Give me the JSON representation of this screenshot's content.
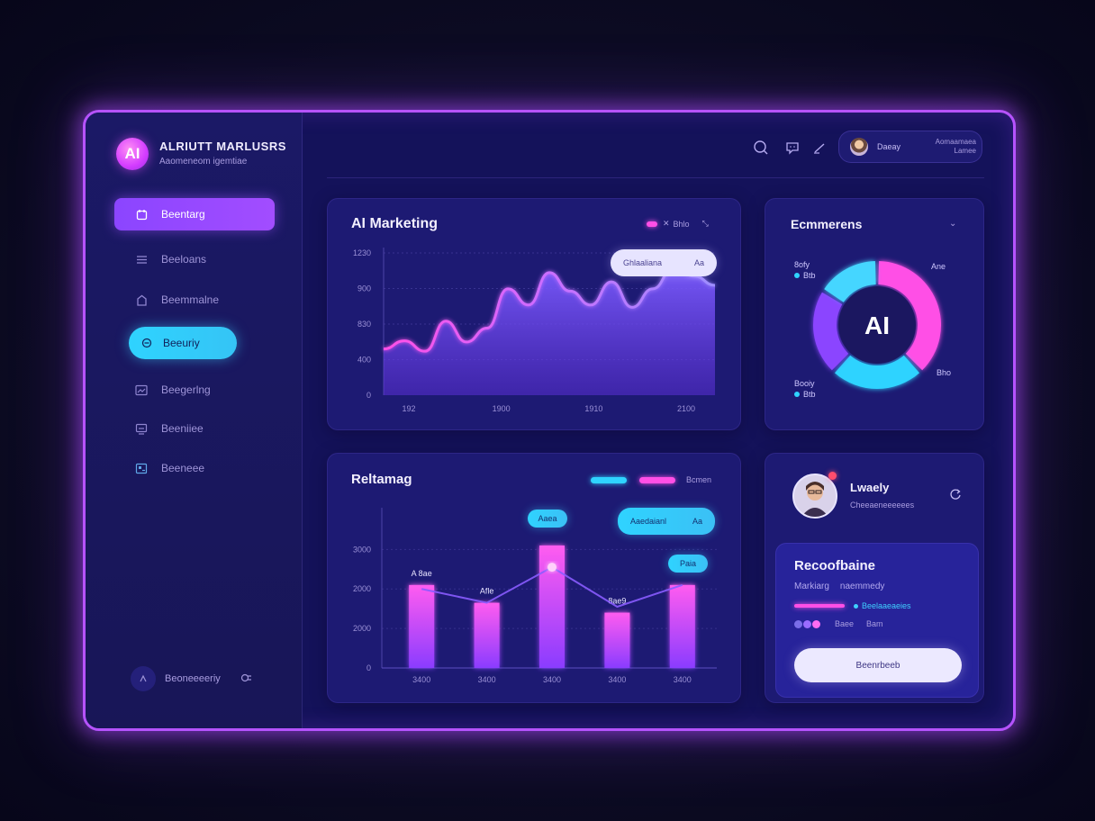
{
  "brand": {
    "logo": "AI",
    "title": "ALRIUTT MARLUSRS",
    "subtitle": "Aaomeneom igemtiae"
  },
  "sidebar": {
    "items": [
      {
        "label": "Beentarg",
        "icon": "calendar-icon"
      },
      {
        "label": "Beeloans",
        "icon": "list-icon"
      },
      {
        "label": "Beemmalne",
        "icon": "home-icon"
      },
      {
        "label": "Beeuriy",
        "icon": "shield-icon"
      },
      {
        "label": "Beegerlng",
        "icon": "image-icon"
      },
      {
        "label": "Beeniiee",
        "icon": "monitor-icon"
      },
      {
        "label": "Beeneee",
        "icon": "grid-icon"
      }
    ],
    "settings_label": "Beoneeeeriy"
  },
  "topbar": {
    "icons": [
      "search-icon",
      "chat-icon",
      "edit-icon"
    ],
    "profile_name": "Daeay",
    "profile_right_top": "Aomaamaea",
    "profile_right_bottom": "Lamee"
  },
  "marketing_card": {
    "title": "AI Marketing",
    "legend_text": "Bhlo",
    "tooltip": "Ghlaaliana",
    "tooltip_suffix": "Aa"
  },
  "ecommerce_card": {
    "title": "Ecmmerens",
    "center_label": "AI",
    "label_tl": "8ofy",
    "label_tl_sub": "Btb",
    "label_tr": "Ane",
    "label_bl": "Booiy",
    "label_bl_sub": "Btb",
    "label_br": "Bho"
  },
  "bar_card": {
    "title": "Reltamag",
    "legend_text": "Bcmen",
    "tooltip_top": "Aaea",
    "tooltip_right": "Aaedaianl",
    "tooltip_right_suffix": "Aa",
    "tooltip_rightmost": "Paia",
    "bar_labels": [
      "A 8ae",
      "Afle",
      "",
      "8ae9",
      ""
    ]
  },
  "profile_card": {
    "name": "Lwaely",
    "subtitle": "Cheeaeneeeeees",
    "rec_title": "Recoofbaine",
    "rec_sub_left": "Markiarg",
    "rec_sub_right": "naemmedy",
    "rec_line_label": "Beelaaeaeies",
    "rec_dots_label": "Baee",
    "rec_dots_right": "Bam",
    "button": "Beenrbeeb"
  },
  "colors": {
    "accent_purple": "#a24dff",
    "accent_cyan": "#2fd3ff",
    "accent_pink": "#ff4fe6",
    "frame": "#b653ff"
  },
  "chart_data": [
    {
      "type": "area",
      "title": "AI Marketing",
      "x_ticks": [
        "192",
        "1900",
        "1910",
        "2100"
      ],
      "y_ticks": [
        "0",
        "400",
        "830",
        "900",
        "1230"
      ],
      "ylim": [
        0,
        1230
      ],
      "x": [
        0,
        1,
        2,
        3,
        4,
        5,
        6,
        7,
        8,
        9,
        10,
        11,
        12,
        13,
        14,
        15,
        16
      ],
      "values": [
        400,
        470,
        380,
        640,
        460,
        580,
        920,
        780,
        1060,
        900,
        780,
        980,
        760,
        920,
        1100,
        1030,
        950
      ],
      "grid": true
    },
    {
      "type": "pie",
      "title": "Ecmmerens",
      "slices": [
        {
          "label": "pink",
          "value": 38,
          "color": "#ff4fe6"
        },
        {
          "label": "cyan-bottom",
          "value": 24,
          "color": "#2fd3ff"
        },
        {
          "label": "purple",
          "value": 22,
          "color": "#8b45ff"
        },
        {
          "label": "cyan-top",
          "value": 16,
          "color": "#45d6ff"
        }
      ]
    },
    {
      "type": "bar",
      "title": "Reltamag",
      "categories": [
        "3400",
        "3400",
        "3400",
        "3400",
        "3400"
      ],
      "values": [
        2100,
        1650,
        3100,
        1400,
        2100
      ],
      "line_values": [
        2000,
        1650,
        2550,
        1550,
        2100
      ],
      "y_ticks": [
        "0",
        "2000",
        "2000",
        "3000"
      ],
      "ylim": [
        0,
        3600
      ]
    }
  ]
}
